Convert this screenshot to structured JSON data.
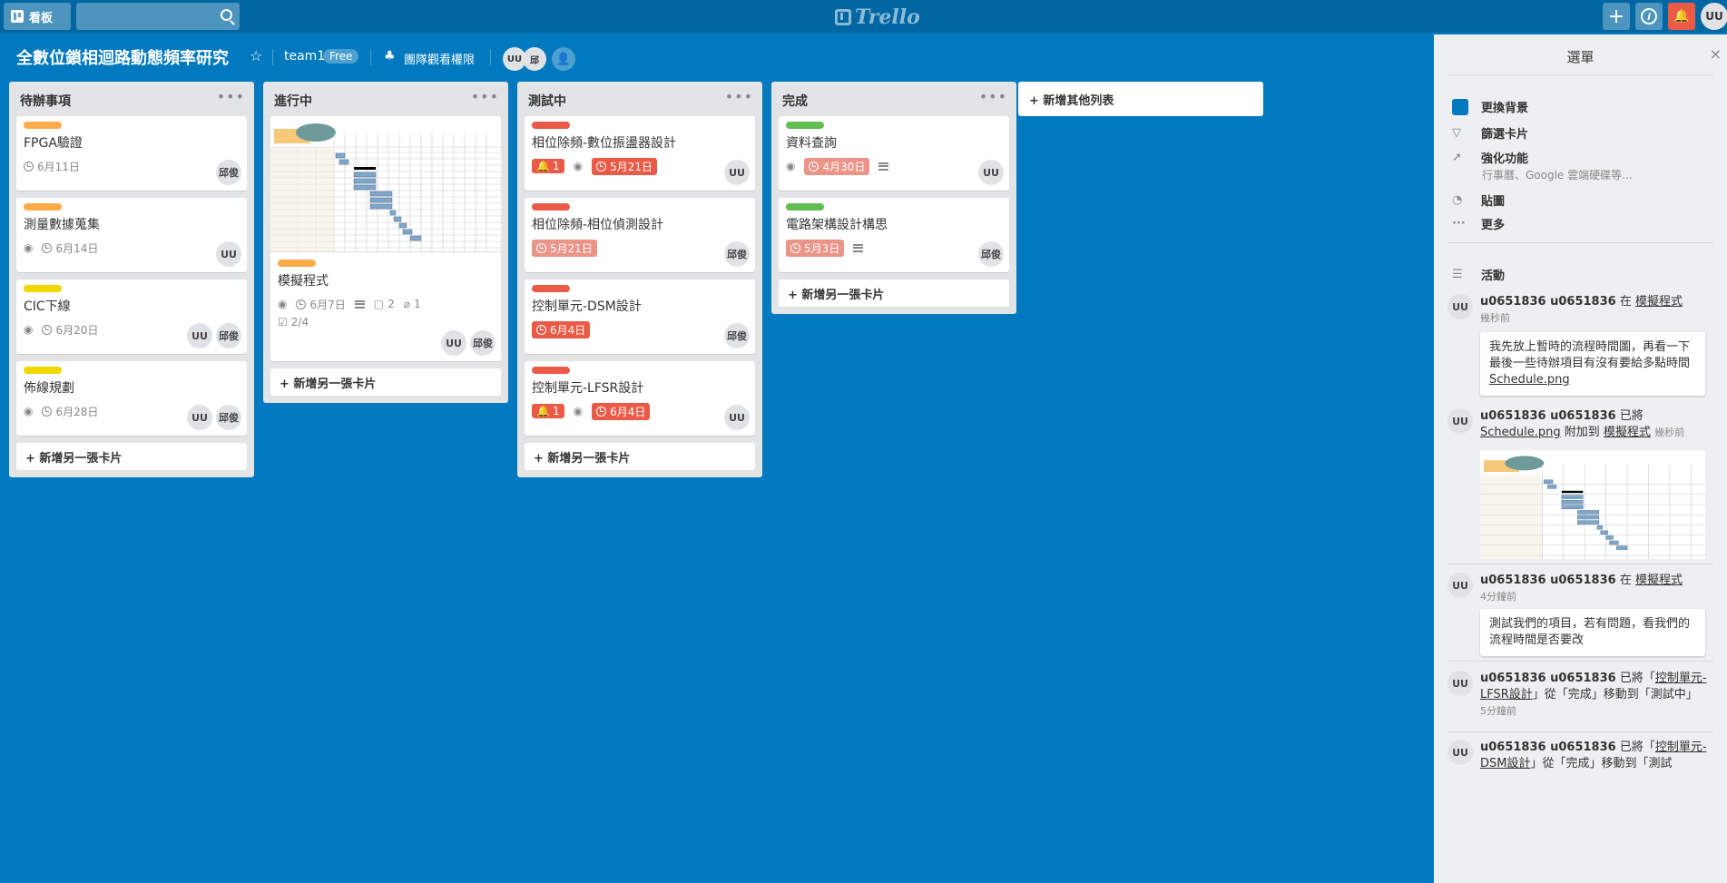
{
  "nav": {
    "boards_label": "看板",
    "search_placeholder": "",
    "logo_text": "Trello",
    "add_label": "+",
    "info_label": "i",
    "bell_label": "🔔",
    "user_initials": "UU"
  },
  "board": {
    "title": "全數位鎖相迴路動態頻率研究",
    "team": "team1",
    "plan": "Free",
    "visibility": "團隊觀看權限",
    "members": [
      "UU",
      "邱"
    ]
  },
  "lists": [
    {
      "title": "待辦事項",
      "cards": [
        {
          "label_color": "#ffab4a",
          "title": "FPGA驗證",
          "due": "6月11日",
          "members": [
            "邱俊"
          ]
        },
        {
          "label_color": "#ffab4a",
          "title": "測量數據蒐集",
          "due": "6月14日",
          "members": [
            "UU"
          ]
        },
        {
          "label_color": "#f2d600",
          "title": "CIC下線",
          "due": "6月20日",
          "members": [
            "UU",
            "邱俊"
          ]
        },
        {
          "label_color": "#f2d600",
          "title": "佈線規劃",
          "due": "6月28日",
          "members": [
            "UU",
            "邱俊"
          ]
        }
      ],
      "add_card": "+ 新增另一張卡片"
    },
    {
      "title": "進行中",
      "cards": [
        {
          "label_color": "#ffab4a",
          "title": "模擬程式",
          "due": "6月7日",
          "comments": "2",
          "attachments": "1",
          "checklist": "2/4",
          "members": [
            "UU",
            "邱俊"
          ]
        }
      ],
      "add_card": "+ 新增另一張卡片"
    },
    {
      "title": "測試中",
      "cards": [
        {
          "label_color": "#eb5a46",
          "title": "相位除頻-數位振盪器設計",
          "notifications": "1",
          "due": "5月21日",
          "members": [
            "UU"
          ]
        },
        {
          "label_color": "#eb5a46",
          "title": "相位除頻-相位偵測設計",
          "due": "5月21日",
          "members": [
            "邱俊"
          ]
        },
        {
          "label_color": "#eb5a46",
          "title": "控制單元-DSM設計",
          "due": "6月4日",
          "members": [
            "邱俊"
          ]
        },
        {
          "label_color": "#eb5a46",
          "title": "控制單元-LFSR設計",
          "notifications": "1",
          "due": "6月4日",
          "members": [
            "UU"
          ]
        }
      ],
      "add_card": "+ 新增另一張卡片"
    },
    {
      "title": "完成",
      "cards": [
        {
          "label_color": "#61bd4f",
          "title": "資料查詢",
          "due": "4月30日",
          "members": [
            "UU"
          ]
        },
        {
          "label_color": "#61bd4f",
          "title": "電路架構設計構思",
          "due": "5月3日",
          "members": [
            "邱俊"
          ]
        }
      ],
      "add_card": "+ 新增另一張卡片"
    }
  ],
  "add_list": "+ 新增其他列表",
  "sidebar": {
    "title": "選單",
    "close": "×",
    "menu": {
      "change_bg": "更換背景",
      "filter": "篩選卡片",
      "powerups": "強化功能",
      "powerups_sub": "行事曆、Google 雲端硬碟等...",
      "stickers": "貼圖",
      "more": "更多",
      "activity": "活動"
    },
    "activities": [
      {
        "avatar": "UU",
        "user": "u0651836 u0651836",
        "verb": "在",
        "target": "模擬程式",
        "time": "幾秒前",
        "comment": "我先放上暫時的流程時間圖，再看一下最後一些待辦項目有沒有要給多點時間",
        "attachment": "Schedule.png"
      },
      {
        "avatar": "UU",
        "user": "u0651836 u0651836",
        "verb": "已將",
        "attachment": "Schedule.png",
        "mid": "附加到",
        "target": "模擬程式",
        "time": "幾秒前"
      },
      {
        "avatar": "UU",
        "user": "u0651836 u0651836",
        "verb": "在",
        "target": "模擬程式",
        "time": "4分鐘前",
        "comment": "測試我們的項目，若有問題，看我們的流程時間是否要改"
      },
      {
        "avatar": "UU",
        "user": "u0651836 u0651836",
        "verb": "已將「",
        "target": "控制單元-LFSR設計",
        "rest": "」從「完成」移動到「測試中」",
        "time": "5分鐘前"
      },
      {
        "avatar": "UU",
        "user": "u0651836 u0651836",
        "verb": "已將「",
        "target": "控制單元-DSM設計",
        "rest": "」從「完成」移動到「測試"
      }
    ]
  }
}
